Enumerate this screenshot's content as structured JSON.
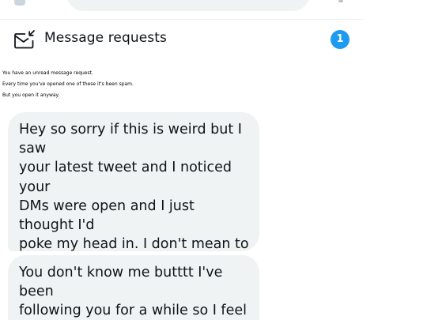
{
  "message_requests": {
    "label": "Message requests",
    "badge_count": "1"
  },
  "notes": [
    "You have an unread message request.",
    "Every time you've opened one of these it's been spam.",
    "But you open it anyway."
  ],
  "messages": [
    {
      "text": "Hey so sorry if this is weird but I saw\nyour latest tweet and I noticed your\nDMs were open and I just thought I'd\npoke my head in. I don't mean to\nintrude so again sorry if this is weird,\njust delete this if you find it\ninappropriate."
    },
    {
      "text": "You don't know me butttt I've been\nfollowing you for a while so I feel like\nI have a good idea of who you are?"
    }
  ],
  "colors": {
    "accent": "#1d9bf0",
    "bubble_bg": "#eff3f4",
    "text": "#0f1419"
  },
  "icons": {
    "requests": "mail-arrow-icon"
  }
}
